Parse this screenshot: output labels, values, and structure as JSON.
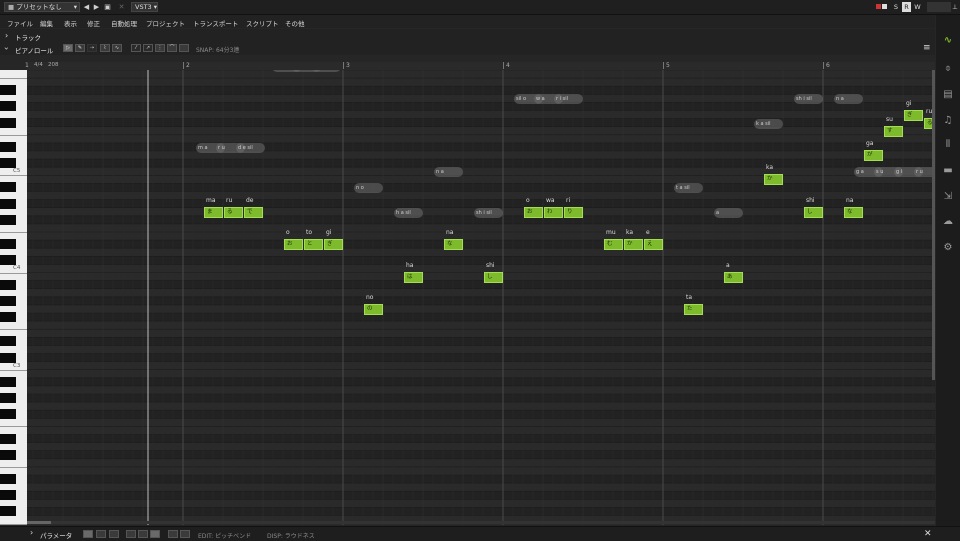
{
  "toolbar": {
    "preset_value": "プリセットなし",
    "preset_caret": "▾",
    "prev": "◀",
    "next": "▶",
    "save": "▣",
    "close": "✕",
    "plugin_value": "VST3 ▾",
    "right_buttons": [
      "S",
      "R",
      "W"
    ],
    "pin": "⊥"
  },
  "menu": {
    "items": [
      "ファイル",
      "編集",
      "表示",
      "修正",
      "自動処理",
      "プロジェクト",
      "トランスポート",
      "スクリプト",
      "その他"
    ]
  },
  "track_section": {
    "label": "トラック",
    "chevron": "›"
  },
  "pianoroll_section": {
    "label": "ピアノロール",
    "chevron": "›",
    "snap": "SNAP: 64分3連",
    "menu_icon": "≡",
    "tools": [
      "▷",
      "✎",
      "⇢",
      "⌇",
      "∿",
      "⁄",
      "↗",
      "⋮",
      "⌒"
    ]
  },
  "ruler": {
    "time_sig": "4/4",
    "tempo": "208",
    "bars": [
      "1",
      "2",
      "3",
      "4",
      "5",
      "6"
    ]
  },
  "keyboard": {
    "labels": [
      "C5",
      "C4",
      "C3"
    ]
  },
  "notes": [
    {
      "lyric": "ma",
      "kana": "ま",
      "phonemes": "m a"
    },
    {
      "lyric": "ru",
      "kana": "る",
      "phonemes": "r u"
    },
    {
      "lyric": "de",
      "kana": "で",
      "phonemes": "d e sil"
    },
    {
      "lyric": "o",
      "kana": "お",
      "phonemes": "sil o"
    },
    {
      "lyric": "to",
      "kana": "と",
      "phonemes": "t o"
    },
    {
      "lyric": "gi",
      "kana": "ぎ",
      "phonemes": "g i"
    },
    {
      "lyric": "no",
      "kana": "の",
      "phonemes": "n o"
    },
    {
      "lyric": "ha",
      "kana": "は",
      "phonemes": "h a sil"
    },
    {
      "lyric": "na",
      "kana": "な",
      "phonemes": "n a"
    },
    {
      "lyric": "shi",
      "kana": "し",
      "phonemes": "sh i sil"
    },
    {
      "lyric": "o",
      "kana": "お",
      "phonemes": "sil o"
    },
    {
      "lyric": "wa",
      "kana": "わ",
      "phonemes": "w a"
    },
    {
      "lyric": "ri",
      "kana": "り",
      "phonemes": "r i sil"
    },
    {
      "lyric": "mu",
      "kana": "む",
      "phonemes": "sil m u"
    },
    {
      "lyric": "ka",
      "kana": "か",
      "phonemes": "k a"
    },
    {
      "lyric": "e",
      "kana": "え",
      "phonemes": "e"
    },
    {
      "lyric": "ta",
      "kana": "た",
      "phonemes": "t a sil"
    },
    {
      "lyric": "a",
      "kana": "あ",
      "phonemes": "a"
    },
    {
      "lyric": "ka",
      "kana": "か",
      "phonemes": "k a sil"
    },
    {
      "lyric": "shi",
      "kana": "し",
      "phonemes": "sh i sil"
    },
    {
      "lyric": "na",
      "kana": "な",
      "phonemes": "n a"
    },
    {
      "lyric": "ga",
      "kana": "が",
      "phonemes": "g a"
    },
    {
      "lyric": "su",
      "kana": "す",
      "phonemes": "s u"
    },
    {
      "lyric": "gi",
      "kana": "ぎ",
      "phonemes": "g i"
    },
    {
      "lyric": "ru",
      "kana": "る",
      "phonemes": "r u"
    }
  ],
  "params": {
    "label": "パラメータ",
    "chevron": "›",
    "edit": "EDIT: ピッチベンド",
    "disp": "DISP: ラウドネス",
    "close": "✕"
  },
  "colors": {
    "note_fill": "#7dbb2c",
    "note_border": "#a5dc55",
    "bg": "#262626"
  }
}
